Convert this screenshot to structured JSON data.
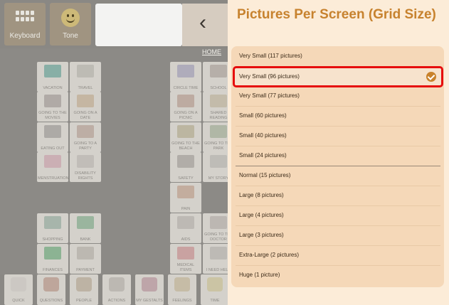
{
  "toolbar": {
    "keyboard_label": "Keyboard",
    "tone_label": "Tone",
    "back_glyph": "‹"
  },
  "home_link": "HOME",
  "left_tiles": [
    {
      "label": "VACATION",
      "color": "#7aa9a0"
    },
    {
      "label": "TRAVEL",
      "color": "#b9b7b0"
    },
    {
      "label": "GOING TO THE MOVIES",
      "color": "#a9a3a0"
    },
    {
      "label": "GOING ON A DATE",
      "color": "#c2b19b"
    },
    {
      "label": "EATING OUT",
      "color": "#a6a3a0"
    },
    {
      "label": "GOING TO A PARTY",
      "color": "#b8a89f"
    },
    {
      "label": "MENSTRUATION",
      "color": "#c9a9b0"
    },
    {
      "label": "DISABILITY RIGHTS",
      "color": "#bdbab5"
    },
    {
      "label": "SHOPPING",
      "color": "#9fb0a6"
    },
    {
      "label": "BANK",
      "color": "#8fb096"
    },
    {
      "label": "FINANCES",
      "color": "#7fae8a"
    },
    {
      "label": "PAYMENT",
      "color": "#b7b4ad"
    }
  ],
  "right_tiles": [
    {
      "label": "CIRCLE TIME",
      "color": "#a8a6b8"
    },
    {
      "label": "SCHOOL",
      "color": "#b0a9a3"
    },
    {
      "label": "GOING ON A PICNIC",
      "color": "#b9a59a"
    },
    {
      "label": "SHARED READING",
      "color": "#c0b7a5"
    },
    {
      "label": "GOING TO THE BEACH",
      "color": "#b7b29a"
    },
    {
      "label": "GOING TO THE PARK",
      "color": "#a9b3a0"
    },
    {
      "label": "SAFETY",
      "color": "#aaa7a2"
    },
    {
      "label": "MY STORY",
      "color": "#bab8b4"
    },
    {
      "label": "PAIN",
      "color": "#c0a796"
    },
    {
      "label": "AIDS",
      "color": "#b8b5b0"
    },
    {
      "label": "GOING TO THE DOCTOR",
      "color": "#b7b3ae"
    },
    {
      "label": "MEDICAL ITEMS",
      "color": "#c79a9a"
    },
    {
      "label": "I NEED HELP",
      "color": "#b9b6b1"
    }
  ],
  "bottom_tiles": [
    {
      "label": "QUICK",
      "color": "#c9c6c0"
    },
    {
      "label": "QUESTIONS",
      "color": "#b89b8f"
    },
    {
      "label": "PEOPLE",
      "color": "#b7ab9a"
    },
    {
      "label": "ACTIONS",
      "color": "#b5b2ab"
    },
    {
      "label": "MY GESTALTS",
      "color": "#b89aa0"
    },
    {
      "label": "FEELINGS",
      "color": "#c2b79c"
    },
    {
      "label": "TIME",
      "color": "#c8c09a"
    }
  ],
  "panel": {
    "title": "Pictures Per Screen (Grid Size)",
    "selected_index": 1,
    "options": [
      "Very Small (117 pictures)",
      "Very Small (96 pictures)",
      "Very Small (77 pictures)",
      "Small (60 pictures)",
      "Small (40 pictures)",
      "Small (24 pictures)",
      "Normal (15 pictures)",
      "Large (8 pictures)",
      "Large (4 pictures)",
      "Large (3 pictures)",
      "Extra-Large (2 pictures)",
      "Huge (1 picture)"
    ]
  },
  "colors": {
    "accent": "#c7822e",
    "selection_border": "#e60d0d",
    "panel_bg": "#fcecd8",
    "card_bg": "#f5d8b8"
  }
}
